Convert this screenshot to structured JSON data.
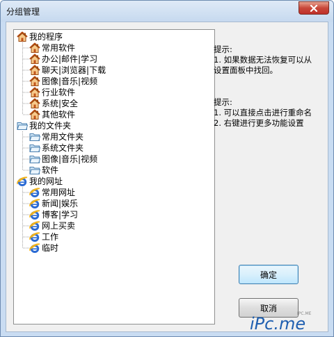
{
  "window": {
    "title": "分组管理"
  },
  "tree": [
    {
      "label": "我的程序",
      "icon": "home",
      "children": [
        "常用软件",
        "办公|邮件|学习",
        "聊天|浏览器|下载",
        "图像|音乐|视频",
        "行业软件",
        "系统|安全",
        "其他软件"
      ]
    },
    {
      "label": "我的文件夹",
      "icon": "folder",
      "children": [
        "常用文件夹",
        "系统文件夹",
        "图像|音乐|视频",
        "软件"
      ]
    },
    {
      "label": "我的网址",
      "icon": "ie",
      "children": [
        "常用网址",
        "新闻|娱乐",
        "博客|学习",
        "网上买卖",
        "工作",
        "临时"
      ]
    }
  ],
  "tips": {
    "tip1": {
      "title": "提示:",
      "lines": [
        "1. 如果数据无法恢复可以从",
        "设置面板中找回。"
      ]
    },
    "tip2": {
      "title": "提示:",
      "lines": [
        "1. 可以直接点击进行重命名",
        "2. 右键进行更多功能设置"
      ]
    }
  },
  "buttons": {
    "ok": "确定",
    "cancel": "取消"
  },
  "watermark": {
    "text": "iPc.me",
    "small": "IPC.ME"
  },
  "colors": {
    "titlebar": "#c6d9ef",
    "accent": "#2a6ad3"
  }
}
